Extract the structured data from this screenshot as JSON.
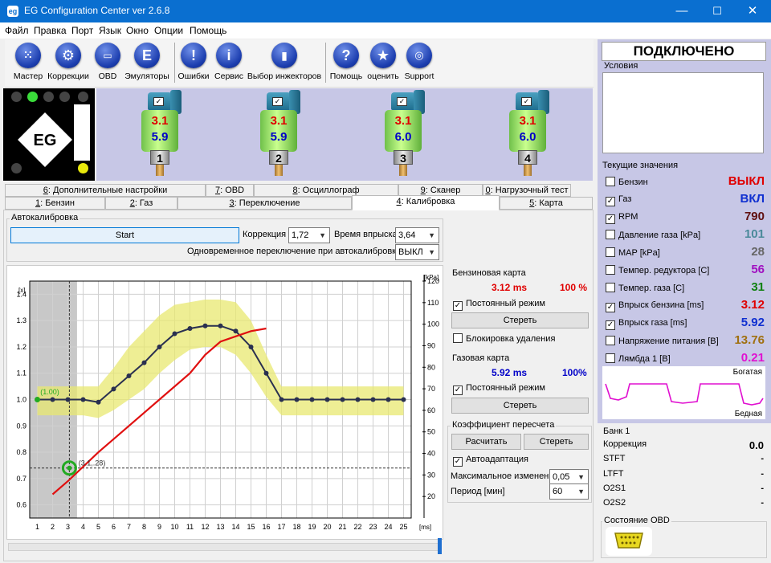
{
  "window": {
    "title": "EG Configuration Center ver 2.6.8",
    "app_icon": "eg-icon",
    "controls": [
      "—",
      "☐",
      "✕"
    ]
  },
  "menu": [
    "Файл",
    "Правка",
    "Порт",
    "Язык",
    "Окно",
    "Опции",
    "Помощь"
  ],
  "toolbar": {
    "buttons": [
      {
        "label": "Мастер",
        "icon": "grid-dots-icon"
      },
      {
        "label": "Коррекции",
        "icon": "gear-icon"
      },
      {
        "label": "OBD",
        "icon": "obd-connector-icon"
      },
      {
        "label": "Эмуляторы",
        "icon": "letter-e-icon"
      },
      {
        "label": "Ошибки",
        "icon": "exclamation-icon"
      },
      {
        "label": "Сервис",
        "icon": "info-icon"
      },
      {
        "label": "Выбор инжекторов",
        "icon": "injector-icon"
      },
      {
        "label": "Помощь",
        "icon": "question-icon"
      },
      {
        "label": "оценить",
        "icon": "star-icon"
      },
      {
        "label": "Support",
        "icon": "chat-bubbles-icon"
      }
    ]
  },
  "injectors": [
    {
      "number": "1",
      "petrol": "3.1",
      "gas": "5.9",
      "checked": "✓"
    },
    {
      "number": "2",
      "petrol": "3.1",
      "gas": "5.9",
      "checked": "✓"
    },
    {
      "number": "3",
      "petrol": "3.1",
      "gas": "6.0",
      "checked": "✓"
    },
    {
      "number": "4",
      "petrol": "3.1",
      "gas": "6.0",
      "checked": "✓"
    }
  ],
  "tabs_row1": [
    {
      "hot": "6",
      "label": ": Дополнительные настройки"
    },
    {
      "hot": "7",
      "label": ": OBD"
    },
    {
      "hot": "8",
      "label": ": Осциллограф"
    },
    {
      "hot": "9",
      "label": ": Сканер"
    },
    {
      "hot": "0",
      "label": ": Нагрузочный тест"
    }
  ],
  "tabs_row2": [
    {
      "hot": "1",
      "label": ": Бензин"
    },
    {
      "hot": "2",
      "label": ": Газ"
    },
    {
      "hot": "3",
      "label": ": Переключение"
    },
    {
      "hot": "4",
      "label": ": Калибровка"
    },
    {
      "hot": "5",
      "label": ": Карта"
    }
  ],
  "autocalib": {
    "group_title": "Автокалибровка",
    "start_label": "Start",
    "correction_label": "Коррекция",
    "correction_value": "1,72",
    "inj_time_label": "Время впрыска",
    "inj_time_value": "3,64",
    "simultaneous_label": "Одновременное переключение при автокалибровке",
    "simultaneous_value": "ВЫКЛ"
  },
  "chart_data": {
    "type": "line",
    "xlabel": "[ms]",
    "ylabel_left": "[x]",
    "ylabel_right": "[kPa]",
    "x_ticks": [
      1,
      2,
      3,
      4,
      5,
      6,
      7,
      8,
      9,
      10,
      11,
      12,
      13,
      14,
      15,
      16,
      17,
      18,
      19,
      20,
      21,
      22,
      23,
      24,
      25
    ],
    "y_left_ticks": [
      "0.6",
      "0.7",
      "0.8",
      "0.9",
      "1.0",
      "1.1",
      "1.2",
      "1.3",
      "1.4"
    ],
    "y_right_ticks": [
      "20",
      "30",
      "40",
      "50",
      "60",
      "70",
      "80",
      "90",
      "100",
      "110",
      "120"
    ],
    "xlim": [
      0.5,
      25.5
    ],
    "ylim_left": [
      0.55,
      1.45
    ],
    "ylim_right": [
      10,
      120
    ],
    "series": [
      {
        "color": "#2a3050",
        "x": [
          1,
          2,
          3,
          4,
          5,
          6,
          7,
          8,
          9,
          10,
          11,
          12,
          13,
          14,
          15,
          16,
          17,
          18,
          19,
          20,
          21,
          22,
          23,
          24,
          25
        ],
        "y": [
          1.0,
          1.0,
          1.0,
          1.0,
          0.99,
          1.04,
          1.09,
          1.14,
          1.2,
          1.25,
          1.27,
          1.28,
          1.28,
          1.26,
          1.2,
          1.1,
          1.0,
          1.0,
          1.0,
          1.0,
          1.0,
          1.0,
          1.0,
          1.0,
          1.0
        ]
      },
      {
        "color": "#e01010",
        "x": [
          2,
          3,
          5,
          7,
          9,
          11,
          12,
          13,
          14,
          15,
          16
        ],
        "y": [
          0.64,
          0.69,
          0.8,
          0.9,
          1.0,
          1.1,
          1.17,
          1.22,
          1.24,
          1.26,
          1.27
        ]
      }
    ],
    "band_upper": [
      1.05,
      1.05,
      1.05,
      1.05,
      1.05,
      1.12,
      1.2,
      1.26,
      1.32,
      1.36,
      1.37,
      1.38,
      1.38,
      1.37,
      1.3,
      1.17,
      1.05,
      1.05,
      1.05,
      1.05,
      1.05,
      1.05,
      1.05,
      1.05,
      1.05
    ],
    "band_lower": [
      0.94,
      0.94,
      0.94,
      0.94,
      0.93,
      0.96,
      1.0,
      1.04,
      1.1,
      1.15,
      1.19,
      1.2,
      1.2,
      1.17,
      1.1,
      1.01,
      0.94,
      0.94,
      0.94,
      0.94,
      0.94,
      0.94,
      0.94,
      0.94,
      0.94
    ],
    "shade_until_x": 3.6,
    "cursor": {
      "x": 3.1,
      "y": 0.74
    },
    "annotations": [
      {
        "text": "(1.00)",
        "x": 1.2,
        "y": 1.02,
        "color": "#22aa22"
      },
      {
        "text": "(3.1,.28)",
        "x": 3.7,
        "y": 0.75,
        "color": "#333333"
      }
    ]
  },
  "petrol_map": {
    "title": "Бензиновая карта",
    "ms": "3.12 ms",
    "pct": "100 %",
    "permanent_label": "Постоянный режим",
    "erase_label": "Стереть",
    "lock_label": "Блокировка удаления"
  },
  "gas_map": {
    "title": "Газовая карта",
    "ms": "5.92 ms",
    "pct": "100%",
    "permanent_label": "Постоянный режим",
    "erase_label": "Стереть"
  },
  "recalc": {
    "title": "Коэффициент пересчета",
    "calc_label": "Расчитать",
    "erase_label": "Стереть",
    "auto_label": "Автоадаптация",
    "max_change_label": "Максимальное изменение",
    "max_change_value": "0,05",
    "period_label": "Период [мин]",
    "period_value": "60"
  },
  "status": {
    "connected": "ПОДКЛЮЧЕНО",
    "conditions_title": "Условия",
    "current_title": "Текущие значения"
  },
  "current_values": [
    {
      "label": "Бензин",
      "value": "ВЫКЛ",
      "checked": "",
      "color": "#e00000"
    },
    {
      "label": "Газ",
      "value": "ВКЛ",
      "checked": "✓",
      "color": "#1030d0"
    },
    {
      "label": "RPM",
      "value": "790",
      "checked": "✓",
      "color": "#601010"
    },
    {
      "label": "Давление газа [kPa]",
      "value": "101",
      "checked": "",
      "color": "#4a8a9a"
    },
    {
      "label": "MAP [kPa]",
      "value": "28",
      "checked": "",
      "color": "#666666"
    },
    {
      "label": "Темпер. редуктора [C]",
      "value": "56",
      "checked": "",
      "color": "#a010c0"
    },
    {
      "label": "Темпер. газа [C]",
      "value": "31",
      "checked": "",
      "color": "#108010"
    },
    {
      "label": "Впрыск бензина [ms]",
      "value": "3.12",
      "checked": "✓",
      "color": "#e00000"
    },
    {
      "label": "Впрыск газа [ms]",
      "value": "5.92",
      "checked": "✓",
      "color": "#1030d0"
    },
    {
      "label": "Напряжение питания [В]",
      "value": "13.76",
      "checked": "",
      "color": "#a07010"
    },
    {
      "label": "Лямбда 1 [В]",
      "value": "0.21",
      "checked": "",
      "color": "#e010d0"
    }
  ],
  "lambda_graph": {
    "rich": "Богатая",
    "lean": "Бедная",
    "color": "#e010d0"
  },
  "bank": {
    "title": "Банк 1",
    "rows": [
      {
        "label": "Коррекция",
        "value": "0.0"
      },
      {
        "label": "STFT",
        "value": "-"
      },
      {
        "label": "LTFT",
        "value": "-"
      },
      {
        "label": "O2S1",
        "value": "-"
      },
      {
        "label": "O2S2",
        "value": "-"
      }
    ]
  },
  "obd_state": {
    "title": "Состояние OBD",
    "icon": "obd-connector-icon"
  }
}
